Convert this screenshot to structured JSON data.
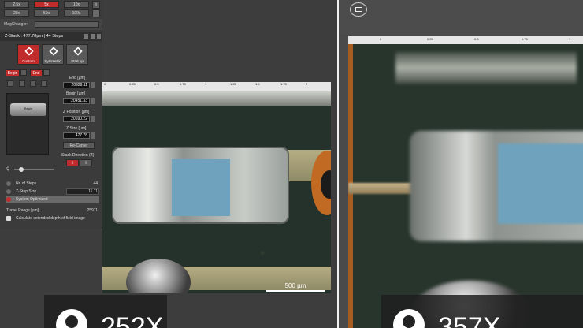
{
  "left_panel": {
    "zoom_buttons_row1": [
      "2.5x",
      "5x",
      "10x"
    ],
    "zoom_buttons_row2": [
      "20x",
      "50x",
      "100x"
    ],
    "active_zoom": "5x",
    "info_icon": "info-icon",
    "magchanger_label": "MagChanger:",
    "zstack_title": "Z-Stack : 477.78µm | 44 Steps",
    "modes": [
      {
        "label": "Custom",
        "icon": "stack-icon",
        "active": true
      },
      {
        "label": "Symmetric",
        "icon": "symmetric-icon",
        "active": false
      },
      {
        "label": "Start up",
        "icon": "startup-icon",
        "active": false
      }
    ],
    "begin_button": "Begin",
    "end_button": "End",
    "end_label": "End [µm]",
    "end_values": [
      "20929.11",
      "20451.33"
    ],
    "begin_label": "Begin [µm]",
    "z_position_label": "Z Position [µm]",
    "z_position_value": "20690.22",
    "z_size_label": "Z Size [µm]",
    "z_size_value": "477.78",
    "recenter_button": "Re-Center",
    "stack_direction_label": "Stack Direction (Z)",
    "stack_graphic_label": "Begin",
    "nr_of_steps_label": "Nr. of Steps",
    "nr_of_steps_value": "44",
    "z_step_size_label": "Z-Step Size",
    "z_step_size_value": "11.11",
    "system_optimized_label": "System Optimized",
    "travel_range_label": "Travel Range [µm]:",
    "travel_range_value": "25911",
    "calc_edof_label": "Calculate extended depth of field image"
  },
  "left_view": {
    "ruler_ticks": [
      "0",
      "0.25",
      "0.5",
      "0.75",
      "1",
      "1.25",
      "1.5",
      "1.75",
      "2"
    ],
    "scale_bar_label": "500 µm",
    "magnification_label": "252X"
  },
  "right_view": {
    "ruler_ticks": [
      "0",
      "0.25",
      "0.5",
      "0.75",
      "1"
    ],
    "magnification_label": "357X"
  },
  "colors": {
    "accent_red": "#c22b2b",
    "pcb_green": "#25322b",
    "chip_blue": "#6fa2bc"
  }
}
